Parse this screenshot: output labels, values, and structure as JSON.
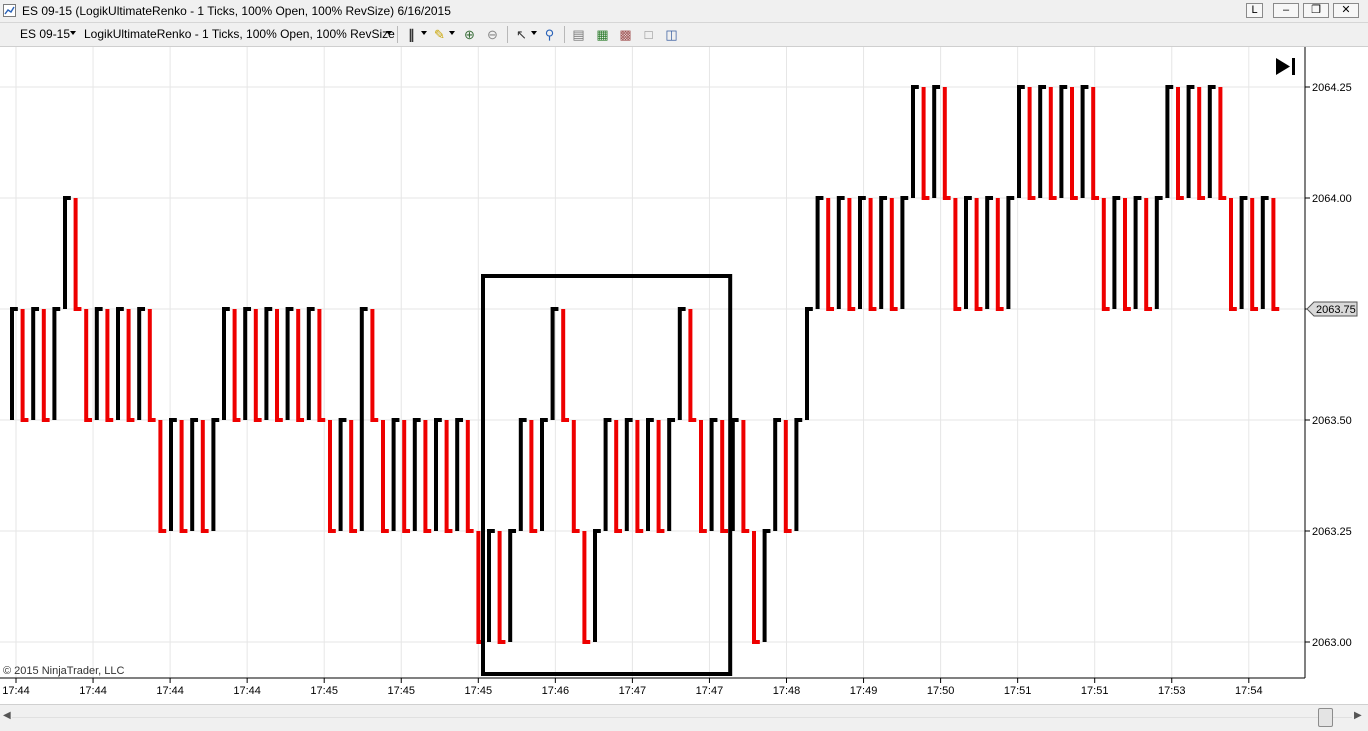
{
  "window": {
    "title": "ES 09-15 (LogikUltimateRenko - 1 Ticks, 100% Open, 100% RevSize)  6/16/2015",
    "buttons": [
      "L",
      "–",
      "❐",
      "✕"
    ]
  },
  "toolbar": {
    "instrument": "ES 09-15",
    "bar_type": "LogikUltimateRenko - 1 Ticks, 100% Open, 100% RevSize",
    "icons": [
      "bar-spacing-icon",
      "pencil-icon",
      "zoom-in-icon",
      "zoom-out-icon",
      "cursor-icon",
      "magnifier-icon",
      "data-box-icon",
      "indicators-icon",
      "strategies-icon",
      "properties-icon",
      "templates-icon"
    ]
  },
  "chart": {
    "copyright": "© 2015 NinjaTrader, LLC",
    "play_end_icon": "▶▏",
    "colors": {
      "up": "#000000",
      "down": "#ee0000",
      "grid": "#e6e6e6",
      "price_tag": "#d9d9d9"
    }
  },
  "chart_data": {
    "type": "line",
    "title": "",
    "xlabel": "",
    "ylabel": "",
    "ylim": [
      2062.94,
      2064.37
    ],
    "y_ticks": [
      2063.0,
      2063.25,
      2063.5,
      2063.75,
      2064.0,
      2064.25
    ],
    "y_tick_labels": [
      "2063.00",
      "2063.25",
      "2063.50",
      "2063.75",
      "2064.00",
      "2064.25"
    ],
    "x_tick_labels": [
      "17:44",
      "17:44",
      "17:44",
      "17:44",
      "17:45",
      "17:45",
      "17:45",
      "17:46",
      "17:47",
      "17:47",
      "17:48",
      "17:49",
      "17:50",
      "17:51",
      "17:51",
      "17:53",
      "17:54"
    ],
    "current_price": "2063.75",
    "grid": true,
    "brick_size": 0.25,
    "brick_closes": [
      2063.75,
      2063.5,
      2063.75,
      2063.5,
      2063.75,
      2064.0,
      2063.75,
      2063.5,
      2063.75,
      2063.5,
      2063.75,
      2063.5,
      2063.75,
      2063.5,
      2063.25,
      2063.5,
      2063.25,
      2063.5,
      2063.25,
      2063.5,
      2063.75,
      2063.5,
      2063.75,
      2063.5,
      2063.75,
      2063.5,
      2063.75,
      2063.5,
      2063.75,
      2063.5,
      2063.25,
      2063.5,
      2063.25,
      2063.75,
      2063.5,
      2063.25,
      2063.5,
      2063.25,
      2063.5,
      2063.25,
      2063.5,
      2063.25,
      2063.5,
      2063.25,
      2063.0,
      2063.25,
      2063.0,
      2063.25,
      2063.5,
      2063.25,
      2063.5,
      2063.75,
      2063.5,
      2063.25,
      2063.0,
      2063.25,
      2063.5,
      2063.25,
      2063.5,
      2063.25,
      2063.5,
      2063.25,
      2063.5,
      2063.75,
      2063.5,
      2063.25,
      2063.5,
      2063.25,
      2063.5,
      2063.25,
      2063.0,
      2063.25,
      2063.5,
      2063.25,
      2063.5,
      2063.75,
      2064.0,
      2063.75,
      2064.0,
      2063.75,
      2064.0,
      2063.75,
      2064.0,
      2063.75,
      2064.0,
      2064.25,
      2064.0,
      2064.25,
      2064.0,
      2063.75,
      2064.0,
      2063.75,
      2064.0,
      2063.75,
      2064.0,
      2064.25,
      2064.0,
      2064.25,
      2064.0,
      2064.25,
      2064.0,
      2064.25,
      2064.0,
      2063.75,
      2064.0,
      2063.75,
      2064.0,
      2063.75,
      2064.0,
      2064.25,
      2064.0,
      2064.25,
      2064.0,
      2064.25,
      2064.0,
      2063.75,
      2064.0,
      2063.75,
      2064.0,
      2063.75
    ],
    "highlight_box_brick_range": [
      45,
      67
    ]
  }
}
